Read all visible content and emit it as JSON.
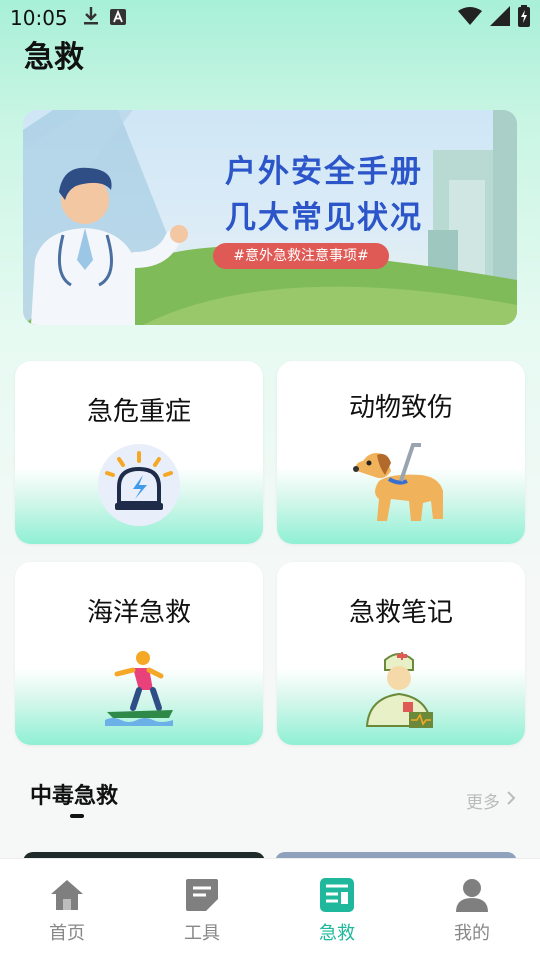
{
  "status_bar": {
    "time": "10:05",
    "icons_left": [
      "download-icon",
      "a-icon"
    ],
    "icons_right": [
      "wifi-icon",
      "signal-icon",
      "battery-icon"
    ]
  },
  "page": {
    "title": "急救"
  },
  "banner": {
    "title_line1": "户外安全手册",
    "title_line2": "几大常见状况",
    "pill": "#意外急救注意事项#"
  },
  "cards": [
    {
      "label": "急危重症",
      "icon": "siren-icon"
    },
    {
      "label": "动物致伤",
      "icon": "dog-icon"
    },
    {
      "label": "海洋急救",
      "icon": "surfer-icon"
    },
    {
      "label": "急救笔记",
      "icon": "doctor-icon"
    }
  ],
  "section": {
    "title": "中毒急救",
    "more": "更多"
  },
  "tabs": [
    {
      "label": "首页",
      "icon": "home-icon",
      "active": false
    },
    {
      "label": "工具",
      "icon": "tool-icon",
      "active": false
    },
    {
      "label": "急救",
      "icon": "firstaid-icon",
      "active": true
    },
    {
      "label": "我的",
      "icon": "profile-icon",
      "active": false
    }
  ],
  "colors": {
    "accent": "#1fb89c",
    "banner_text": "#2b55c9",
    "pill": "#e05a55"
  }
}
